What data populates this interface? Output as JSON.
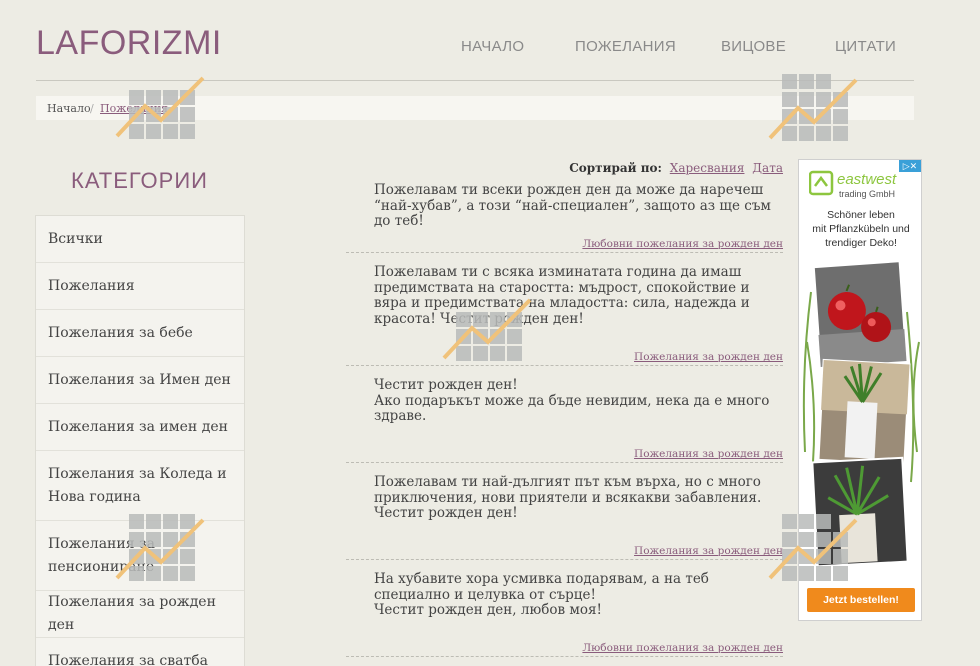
{
  "site": {
    "logo": "LAFORIZMI"
  },
  "nav": {
    "items": [
      "НАЧАЛО",
      "ПОЖЕЛАНИЯ",
      "ВИЦОВЕ",
      "ЦИТАТИ"
    ]
  },
  "breadcrumb": {
    "home": "Начало",
    "separator": "/",
    "current": "Пожелания"
  },
  "sidebar": {
    "title": "КАТЕГОРИИ",
    "items": [
      "Всички",
      "Пожелания",
      "Пожелания за бебе",
      "Пожелания за Имен ден",
      "Пожелания за имен ден",
      "Пожелания за Коледа и Нова година",
      "Пожелания за пенсиониране",
      "Пожелания за рожден ден",
      "Пожелания за сватба"
    ]
  },
  "sort": {
    "label": "Сортирай по:",
    "likes": "Харесвания",
    "date": "Дата"
  },
  "posts": [
    {
      "text": "Пожелавам ти всеки рожден ден да може да наречеш “най-хубав”, а този “най-специален”, защото аз ще съм до теб!",
      "tag": "Любовни пожелания за рожден ден"
    },
    {
      "text": "Пожелавам ти с всяка изминатата година да имаш предимствата на старостта: мъдрост, спокойствие и вяра и предимствата на младостта: сила, надежда и красота! Честит рожден ден!",
      "tag": "Пожелания за рожден ден"
    },
    {
      "text": "Честит рожден ден!\nАко подаръкът може да бъде невидим, нека да е много здраве.",
      "tag": "Пожелания за рожден ден"
    },
    {
      "text": "Пожелавам ти най-дългият път към върха, но с много приключения, нови приятели и всякакви забавления. Честит рожден ден!",
      "tag": "Пожелания за рожден ден"
    },
    {
      "text": "На хубавите хора усмивка подарявам, а на теб специално и целувка от сърце!\nЧестит рожден ден, любов моя!",
      "tag": "Любовни пожелания за рожден ден"
    }
  ],
  "ad": {
    "brand_top": "eastwest",
    "brand_bottom": "trading GmbH",
    "text": "Schöner leben\nmit Pflanzkübeln und\ntrendiger Deko!",
    "cta": "Jetzt bestellen!",
    "brand_color": "#8dc63f",
    "cta_color": "#f08a1c"
  },
  "colors": {
    "accent": "#8a5c7c",
    "background": "#edece4"
  }
}
